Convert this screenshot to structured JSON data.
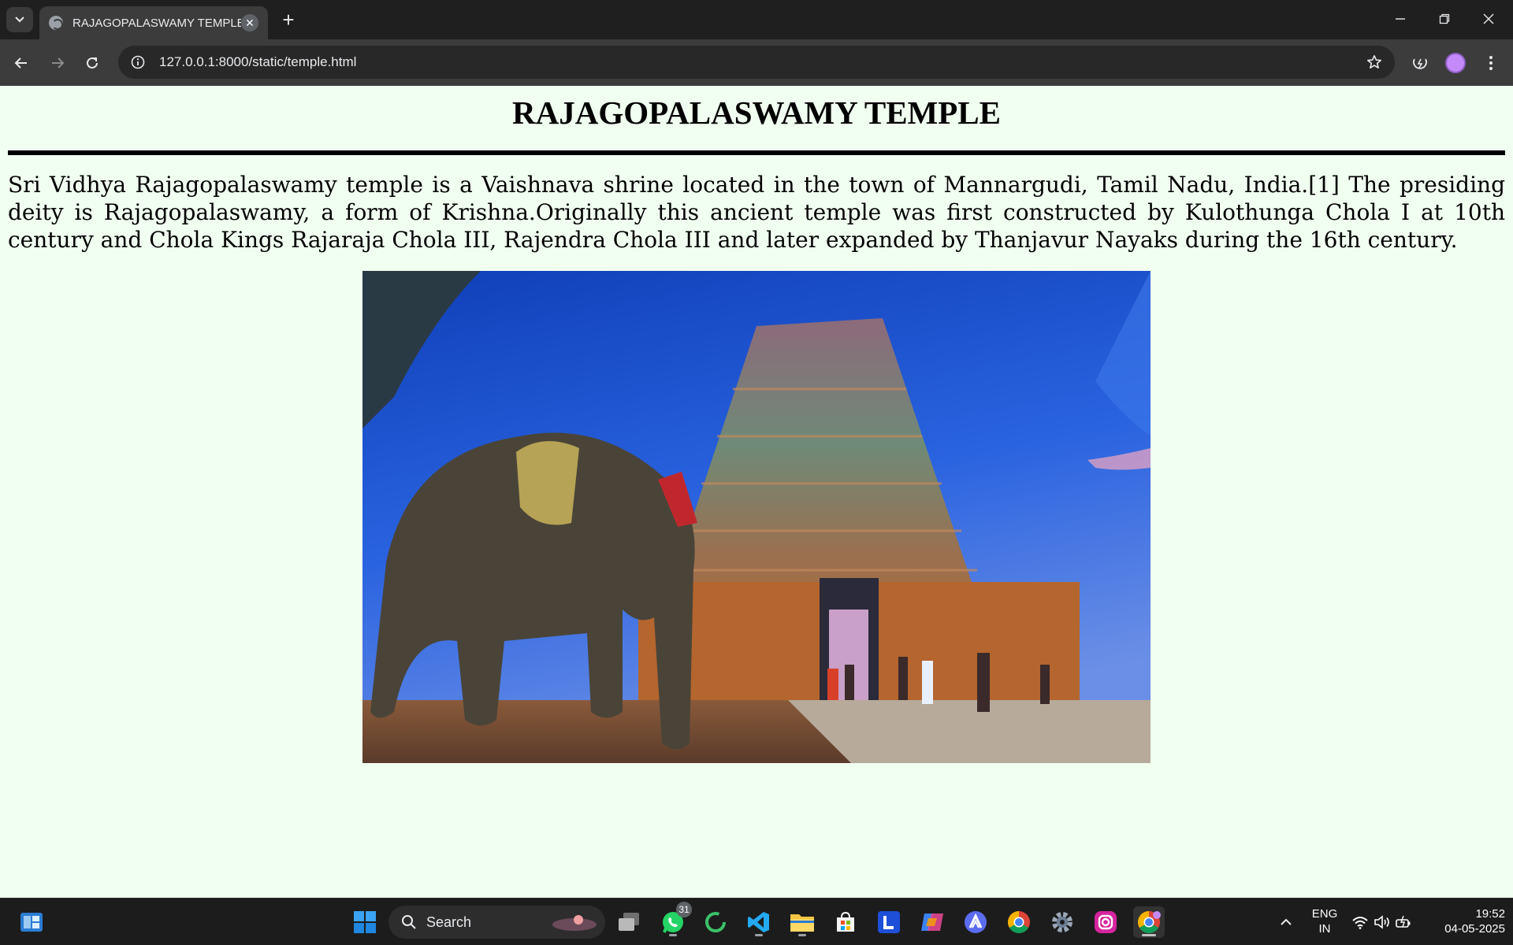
{
  "browser": {
    "tab": {
      "title": "RAJAGOPALASWAMY TEMPLE",
      "close_glyph": "✕"
    },
    "new_tab_glyph": "+",
    "url": "127.0.0.1:8000/static/temple.html",
    "window_controls": {
      "minimize": "—",
      "restore": "❐",
      "close": "✕"
    }
  },
  "page": {
    "title": "RAJAGOPALASWAMY TEMPLE",
    "intro": "Sri Vidhya Rajagopalaswamy temple is a Vaishnava shrine located in the town of Mannargudi, Tamil Nadu, India.[1] The presiding deity is Rajagopalaswamy, a form of Krishna.Originally this ancient temple was first constructed by Kulothunga Chola I at 10th century and Chola Kings Rajaraja Chola III, Rajendra Chola III and later expanded by Thanjavur Nayaks during the 16th century.",
    "background_color": "#f0fff0"
  },
  "taskbar": {
    "search_label": "Search",
    "whatsapp_badge": "31",
    "language": "ENG",
    "region": "IN",
    "time": "19:52",
    "date": "04-05-2025"
  },
  "colors": {
    "chrome_frame": "#1f1f1f",
    "toolbar": "#3c3c3c",
    "omnibox": "#282828",
    "taskbar": "#1c1c1c"
  }
}
